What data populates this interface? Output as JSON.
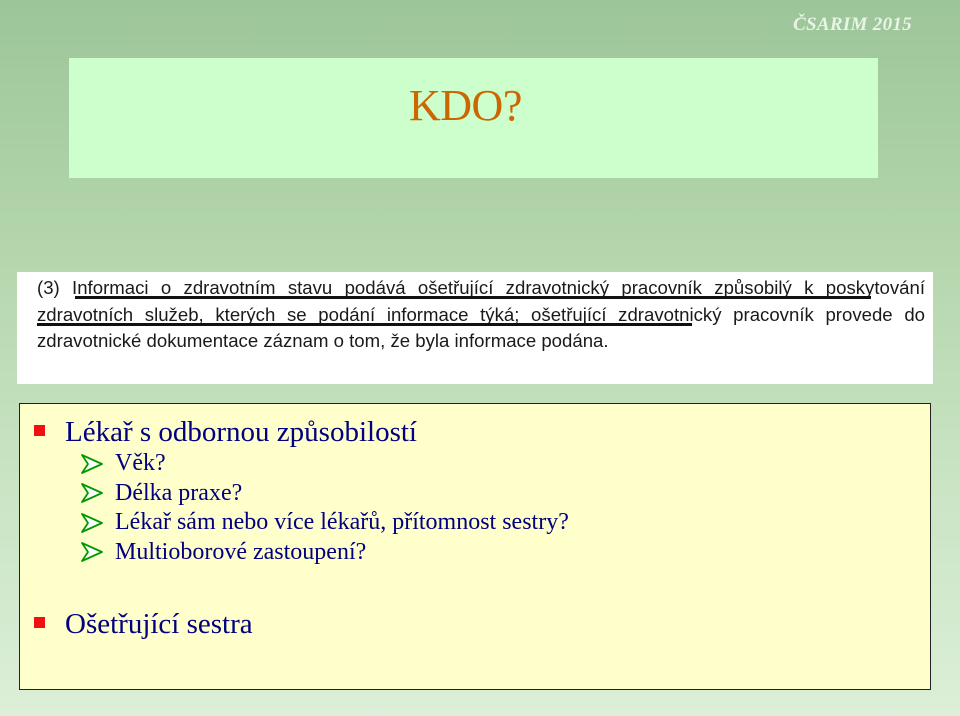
{
  "header": {
    "brand": "ČSARIM 2015"
  },
  "slide": {
    "title": "KDO?"
  },
  "law_excerpt": {
    "text": "(3) Informaci o zdravotním stavu podává ošetřující zdravotnický pracovník způsobilý k poskytování zdravotních služeb, kterých se podání informace týká; ošetřující zdravotnický pracovník provede do zdravotnické dokumentace záznam o tom, že byla informace podána."
  },
  "bullets": [
    {
      "label": "Lékař s odbornou způsobilostí",
      "subitems": [
        "Věk?",
        "Délka praxe?",
        "Lékař sám nebo více lékařů, přítomnost sestry?",
        "Multioborové zastoupení?"
      ]
    },
    {
      "label": "Ošetřující sestra",
      "subitems": []
    }
  ],
  "colors": {
    "title": "#cc6600",
    "bullet_text": "#000080",
    "bullet_marker": "#ee1111",
    "title_box": "#ccffcc",
    "content_box": "#ffffcc"
  },
  "icons": {
    "bullet": "red-square-bullet-icon",
    "sub_bullet": "green-arrowhead-icon"
  }
}
